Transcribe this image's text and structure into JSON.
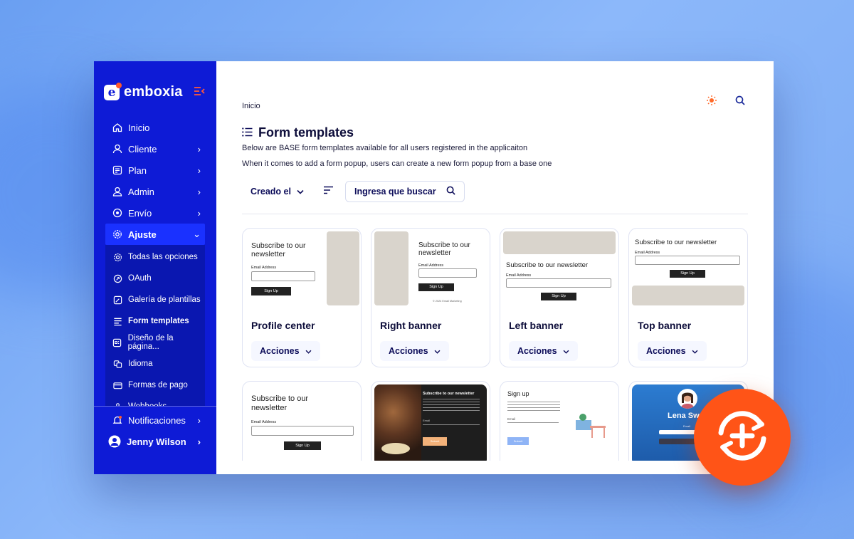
{
  "brand": {
    "name": "emboxia",
    "logo_letter": "e"
  },
  "sidebar": {
    "items": [
      {
        "label": "Inicio",
        "icon": "home-icon",
        "has_chevron": false
      },
      {
        "label": "Cliente",
        "icon": "user-icon",
        "has_chevron": true
      },
      {
        "label": "Plan",
        "icon": "plan-icon",
        "has_chevron": true
      },
      {
        "label": "Admin",
        "icon": "admin-icon",
        "has_chevron": true
      },
      {
        "label": "Envío",
        "icon": "send-icon",
        "has_chevron": true
      },
      {
        "label": "Ajuste",
        "icon": "gear-icon",
        "has_chevron": true,
        "expanded": true
      }
    ],
    "subitems": [
      {
        "label": "Todas las opciones",
        "icon": "gear-icon"
      },
      {
        "label": "OAuth",
        "icon": "oauth-icon"
      },
      {
        "label": "Galería de plantillas",
        "icon": "gallery-icon"
      },
      {
        "label": "Form templates",
        "icon": "form-icon",
        "active": true
      },
      {
        "label": "Diseño de la página...",
        "icon": "page-design-icon"
      },
      {
        "label": "Idioma",
        "icon": "language-icon"
      },
      {
        "label": "Formas de pago",
        "icon": "card-icon"
      },
      {
        "label": "Webhooks",
        "icon": "webhook-icon"
      }
    ],
    "notifications_label": "Notificaciones",
    "user_name": "Jenny Wilson"
  },
  "header": {
    "breadcrumb": "Inicio"
  },
  "page": {
    "title": "Form templates",
    "desc1": "Below are BASE form templates available for all users registered in the applicaiton",
    "desc2": "When it comes to add a form popup, users can create a new form popup from a base one"
  },
  "toolbar": {
    "sort_label": "Creado el",
    "search_placeholder": "Ingresa que buscar"
  },
  "cards": [
    {
      "name": "Profile center",
      "action": "Acciones"
    },
    {
      "name": "Right banner",
      "action": "Acciones"
    },
    {
      "name": "Left banner",
      "action": "Acciones"
    },
    {
      "name": "Top banner",
      "action": "Acciones"
    }
  ],
  "previews": {
    "subscribe": "Subscribe to our newsletter",
    "email": "Email Address",
    "signup": "Sign Up",
    "signup2": "Sign up",
    "lena": "Lena Sw",
    "footer": "© 2024 Email Marketing",
    "email_short": "Email",
    "submit": "Submit"
  },
  "colors": {
    "sidebar": "#0e1bd6",
    "accent": "#ff5417",
    "active": "#1a31ff"
  }
}
